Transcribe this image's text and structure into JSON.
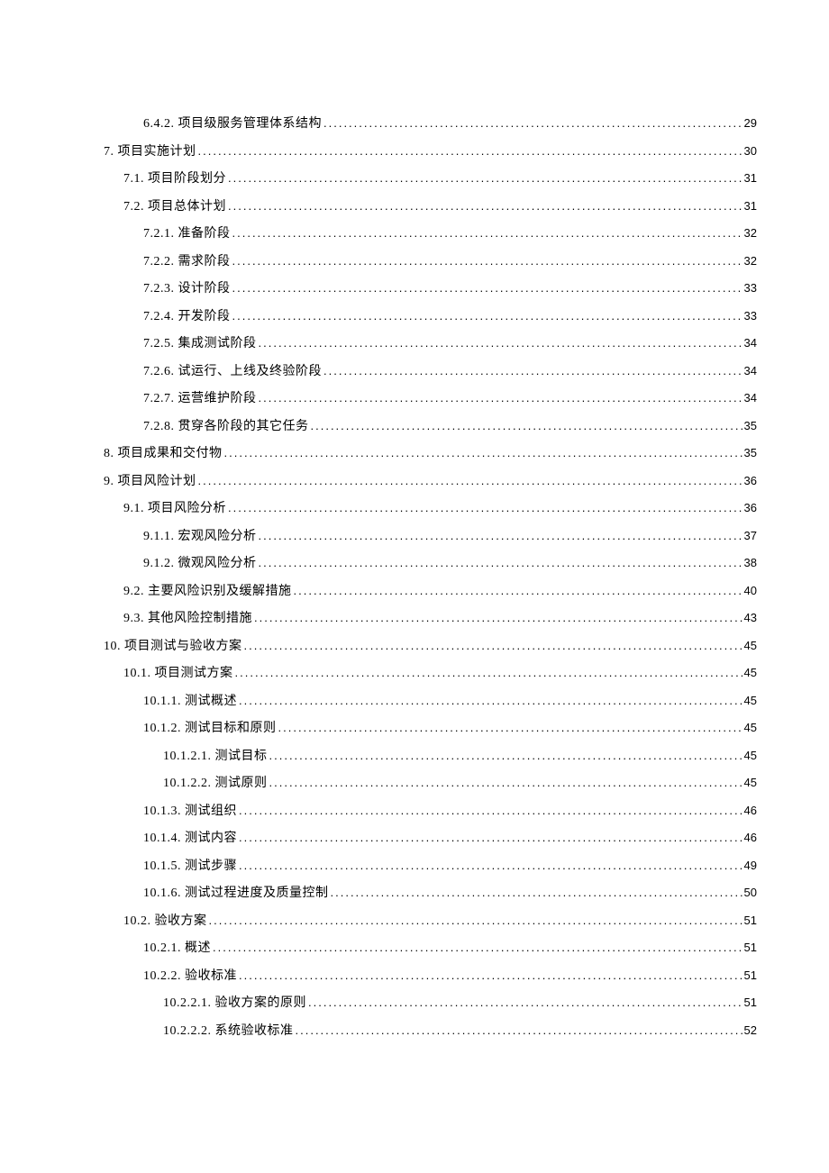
{
  "toc": [
    {
      "level": 2,
      "title": "6.4.2.  项目级服务管理体系结构",
      "page": "29"
    },
    {
      "level": 0,
      "title": "7.  项目实施计划",
      "page": "30"
    },
    {
      "level": 1,
      "title": "7.1.  项目阶段划分",
      "page": "31"
    },
    {
      "level": 1,
      "title": "7.2.  项目总体计划",
      "page": "31"
    },
    {
      "level": 2,
      "title": "7.2.1.  准备阶段",
      "page": "32"
    },
    {
      "level": 2,
      "title": "7.2.2.  需求阶段",
      "page": "32"
    },
    {
      "level": 2,
      "title": "7.2.3.  设计阶段",
      "page": "33"
    },
    {
      "level": 2,
      "title": "7.2.4.  开发阶段",
      "page": "33"
    },
    {
      "level": 2,
      "title": "7.2.5.  集成测试阶段",
      "page": "34"
    },
    {
      "level": 2,
      "title": "7.2.6.  试运行、上线及终验阶段",
      "page": "34"
    },
    {
      "level": 2,
      "title": "7.2.7.  运营维护阶段",
      "page": "34"
    },
    {
      "level": 2,
      "title": "7.2.8.  贯穿各阶段的其它任务",
      "page": "35"
    },
    {
      "level": 0,
      "title": "8.  项目成果和交付物",
      "page": "35"
    },
    {
      "level": 0,
      "title": "9.  项目风险计划",
      "page": "36"
    },
    {
      "level": 1,
      "title": "9.1.  项目风险分析",
      "page": "36"
    },
    {
      "level": 2,
      "title": "9.1.1.  宏观风险分析",
      "page": "37"
    },
    {
      "level": 2,
      "title": "9.1.2.  微观风险分析",
      "page": "38"
    },
    {
      "level": 1,
      "title": "9.2.  主要风险识别及缓解措施",
      "page": "40"
    },
    {
      "level": 1,
      "title": "9.3.  其他风险控制措施",
      "page": "43"
    },
    {
      "level": 0,
      "title": "10.  项目测试与验收方案",
      "page": "45"
    },
    {
      "level": 1,
      "title": "10.1.  项目测试方案",
      "page": "45"
    },
    {
      "level": 2,
      "title": "10.1.1.  测试概述",
      "page": "45"
    },
    {
      "level": 2,
      "title": "10.1.2.  测试目标和原则",
      "page": "45"
    },
    {
      "level": 3,
      "title": "10.1.2.1.  测试目标",
      "page": "45"
    },
    {
      "level": 3,
      "title": "10.1.2.2.  测试原则",
      "page": "45"
    },
    {
      "level": 2,
      "title": "10.1.3.  测试组织",
      "page": "46"
    },
    {
      "level": 2,
      "title": "10.1.4.  测试内容",
      "page": "46"
    },
    {
      "level": 2,
      "title": "10.1.5.  测试步骤",
      "page": "49"
    },
    {
      "level": 2,
      "title": "10.1.6.  测试过程进度及质量控制",
      "page": "50"
    },
    {
      "level": 1,
      "title": "10.2.  验收方案",
      "page": "51"
    },
    {
      "level": 2,
      "title": "10.2.1.  概述",
      "page": "51"
    },
    {
      "level": 2,
      "title": "10.2.2.  验收标准",
      "page": "51"
    },
    {
      "level": 3,
      "title": "10.2.2.1.  验收方案的原则",
      "page": "51"
    },
    {
      "level": 3,
      "title": "10.2.2.2.  系统验收标准",
      "page": "52"
    }
  ]
}
